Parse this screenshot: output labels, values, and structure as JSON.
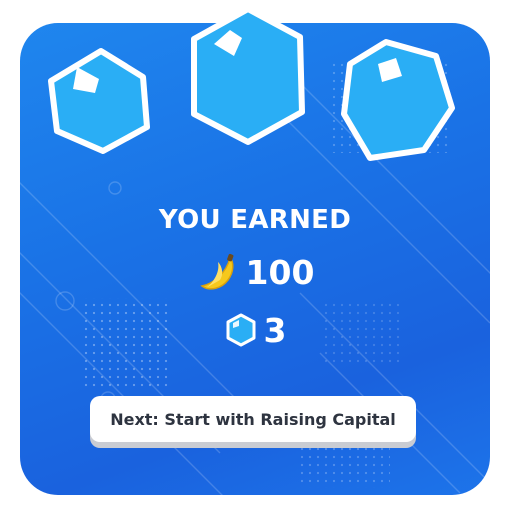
{
  "reward": {
    "title": "YOU EARNED",
    "bananas": {
      "icon": "banana-icon",
      "amount": "100"
    },
    "gems": {
      "icon": "gem-icon",
      "amount": "3"
    }
  },
  "earned_gem_icons": [
    "gem-icon",
    "gem-icon",
    "gem-icon"
  ],
  "next_button": {
    "label": "Next: Start with Raising Capital"
  },
  "colors": {
    "card_background": "#1a6fe4",
    "gem_fill": "#2aaef5",
    "gem_border": "#ffffff",
    "text": "#ffffff",
    "button_text": "#2e3440",
    "banana": "#f6c81c"
  }
}
